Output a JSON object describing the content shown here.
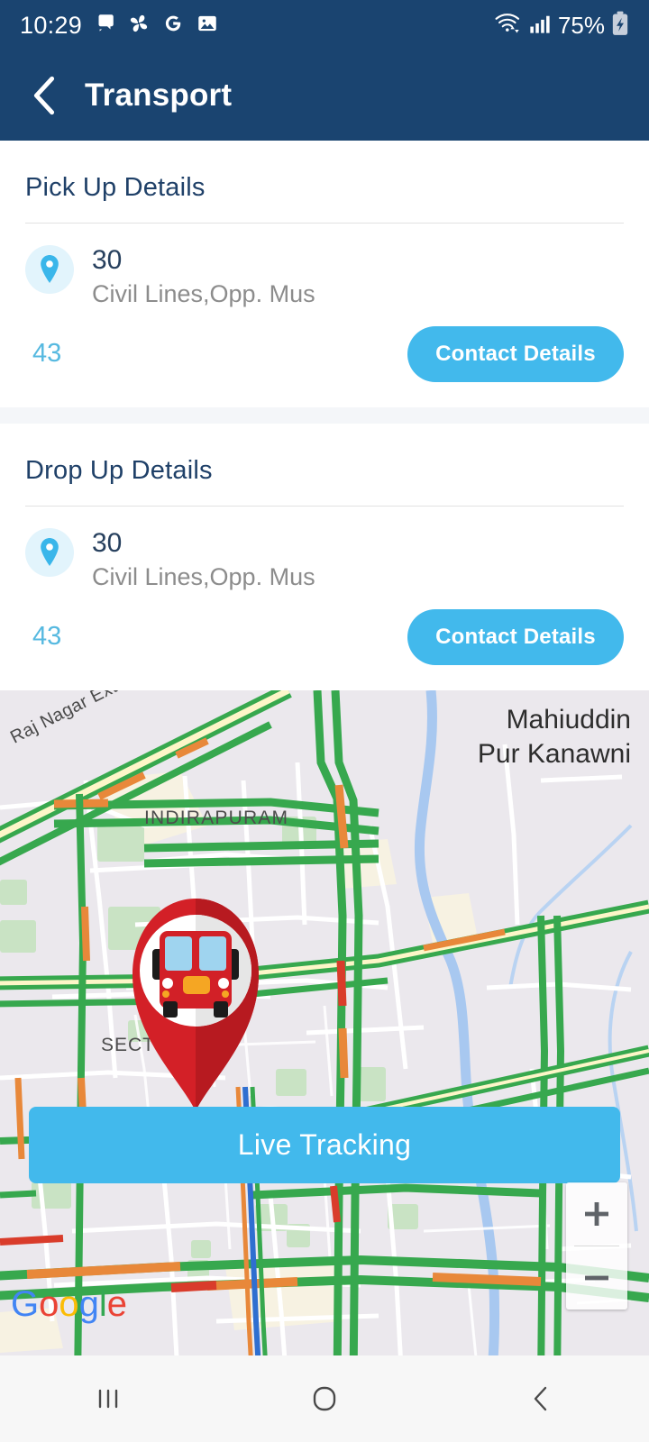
{
  "status_bar": {
    "time": "10:29",
    "battery_text": "75%",
    "icons": [
      "chat-icon",
      "pinwheel-icon",
      "google-g-icon",
      "gallery-icon",
      "wifi-icon",
      "signal-icon",
      "battery-charging-icon"
    ]
  },
  "app_bar": {
    "title": "Transport",
    "back_icon": "back-chevron-icon"
  },
  "pickup": {
    "title": "Pick Up Details",
    "code": "30",
    "address": "Civil Lines,Opp. Mus",
    "number": "43",
    "button_label": "Contact Details"
  },
  "dropup": {
    "title": "Drop Up Details",
    "code": "30",
    "address": "Civil Lines,Opp. Mus",
    "number": "43",
    "button_label": "Contact Details"
  },
  "map": {
    "labels": {
      "mahiuddin": "Mahiuddin\nPur Kanawni",
      "indirapuram": "INDIRAPURAM",
      "sector63": "SECTOR 63",
      "sector_partial": "SECT",
      "raj_nagar": "Raj Nagar Extension Elevated Rd"
    },
    "attribution": {
      "letters": [
        "G",
        "o",
        "o",
        "g",
        "l",
        "e"
      ],
      "colors": [
        "#4285F4",
        "#EA4335",
        "#FBBC05",
        "#4285F4",
        "#34A853",
        "#EA4335"
      ]
    },
    "marker": "bus-map-pin",
    "zoom_in_label": "+",
    "zoom_out_label": "−",
    "live_button_label": "Live Tracking"
  },
  "nav_bar": {
    "recents": "recents-icon",
    "home": "home-icon",
    "back": "back-icon"
  },
  "colors": {
    "header": "#1a4470",
    "accent": "#42b9ec",
    "title_text": "#1f4068",
    "address_text": "#8c8c8c",
    "map_bg": "#ebe8ed",
    "marker_red": "#d32027"
  }
}
